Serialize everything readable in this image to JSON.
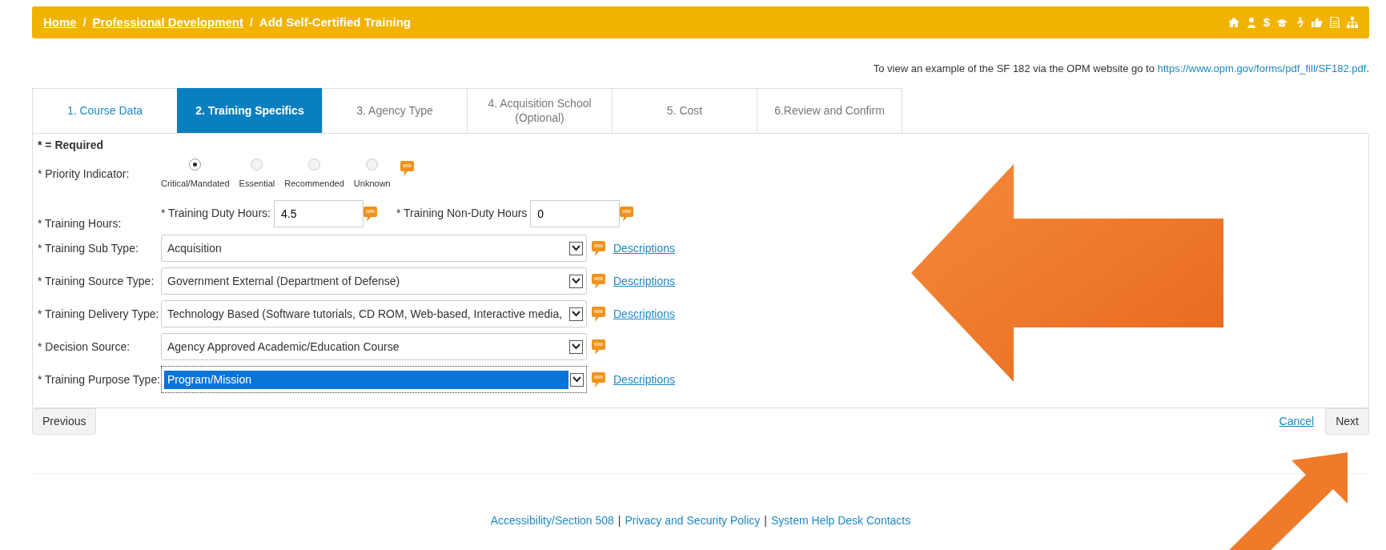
{
  "breadcrumb": [
    {
      "label": "Home",
      "link": true
    },
    {
      "label": "Professional Development",
      "link": true
    },
    {
      "label": "Add Self-Certified Training",
      "link": false
    }
  ],
  "breadcrumb_separator": "/",
  "currency_symbol": "$",
  "opm_note": {
    "text": "To view an example of the SF 182 via the OPM website go to",
    "link": "https://www.opm.gov/forms/pdf_fill/SF182.pdf",
    "end": "."
  },
  "tabs": [
    {
      "label": "1. Course Data",
      "selected": false,
      "completed": true
    },
    {
      "label": "2. Training Specifics",
      "selected": true,
      "completed": false
    },
    {
      "label": "3. Agency Type",
      "selected": false,
      "completed": false
    },
    {
      "label": "4. Acquisition School (Optional)",
      "selected": false,
      "completed": false
    },
    {
      "label": "5. Cost",
      "selected": false,
      "completed": false
    },
    {
      "label": "6.Review and Confirm",
      "selected": false,
      "completed": false
    }
  ],
  "required_note": "* = Required",
  "priority": {
    "label": "* Priority Indicator:",
    "options": [
      {
        "label": "Critical/Mandated",
        "selected": true
      },
      {
        "label": "Essential",
        "selected": false
      },
      {
        "label": "Recommended",
        "selected": false
      },
      {
        "label": "Unknown",
        "selected": false
      }
    ]
  },
  "hours": {
    "label": "* Training Hours:",
    "duty_label": "* Training Duty Hours:",
    "duty_value": "4.5",
    "nonduty_label": "* Training Non-Duty Hours",
    "nonduty_value": "0"
  },
  "selects": [
    {
      "label": "* Training Sub Type:",
      "value": "Acquisition",
      "focused": false,
      "descriptions": "Descriptions"
    },
    {
      "label": "* Training Source Type:",
      "value": "Government External (Department of Defense)",
      "focused": false,
      "descriptions": "Descriptions"
    },
    {
      "label": "* Training Delivery Type:",
      "value": "Technology Based (Software tutorials, CD ROM, Web-based, Interactive media,",
      "focused": false,
      "descriptions": "Descriptions"
    },
    {
      "label": "* Decision Source:",
      "value": "Agency Approved Academic/Education Course",
      "focused": false
    },
    {
      "label": "* Training Purpose Type:",
      "value": "Program/Mission",
      "focused": true,
      "descriptions": "Descriptions"
    }
  ],
  "buttons": {
    "previous": "Previous",
    "cancel": "Cancel",
    "next": "Next"
  },
  "footer": [
    {
      "kind": "link",
      "text": "Accessibility/Section 508"
    },
    {
      "kind": "sep",
      "text": "|"
    },
    {
      "kind": "link",
      "text": "Privacy and Security Policy"
    },
    {
      "kind": "sep",
      "text": "|"
    },
    {
      "kind": "link",
      "text": "System Help Desk Contacts"
    }
  ]
}
